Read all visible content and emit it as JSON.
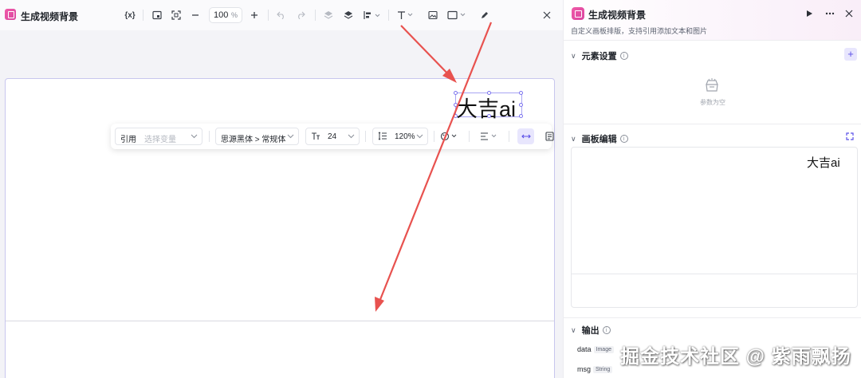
{
  "editor": {
    "title": "生成视频背景",
    "zoom": {
      "value": "100",
      "unit": "%"
    },
    "canvas_text": "大吉ai"
  },
  "floatbar": {
    "ref_label": "引用",
    "ref_placeholder": "选择变量",
    "font": "思源黑体 > 常规体",
    "font_size": "24",
    "line_height": "120%"
  },
  "panel": {
    "title": "生成视频背景",
    "description": "自定义画板排版，支持引用添加文本和图片",
    "sections": {
      "elements": {
        "title": "元素设置",
        "empty_text": "参数为空"
      },
      "board": {
        "title": "画板编辑",
        "preview_text": "大吉ai"
      },
      "output": {
        "title": "输出",
        "items": [
          {
            "name": "data",
            "type": "Image"
          },
          {
            "name": "msg",
            "type": "String"
          }
        ]
      }
    }
  },
  "watermark": "掘金技术社区 @ 紫雨飘扬",
  "colors": {
    "accent": "#5b50e8",
    "brand": "#e04fa4",
    "arrow": "#e8524f"
  }
}
